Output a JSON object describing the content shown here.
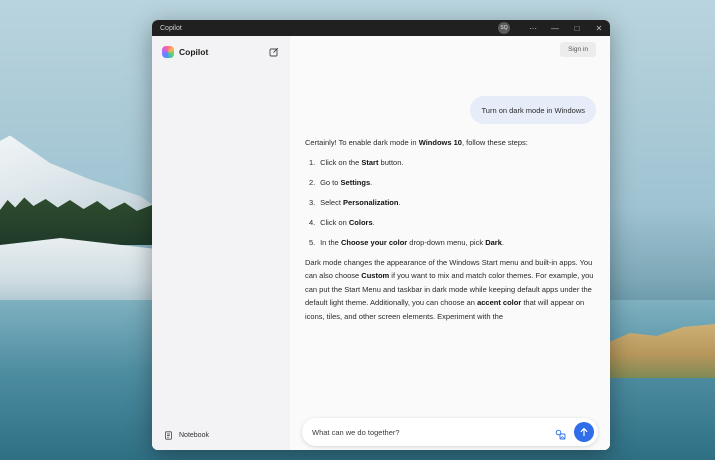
{
  "window": {
    "title": "Copilot",
    "avatar_initials": "SQ",
    "controls": {
      "more": "⋯",
      "minimize": "—",
      "maximize": "□",
      "close": "✕"
    }
  },
  "sidebar": {
    "brand": "Copilot",
    "notebook_label": "Notebook"
  },
  "header": {
    "signin_label": "Sign in"
  },
  "chat": {
    "user_message": "Turn on dark mode in Windows",
    "answer": {
      "intro_pre": "Certainly! To enable dark mode in ",
      "intro_bold": "Windows 10",
      "intro_post": ", follow these steps:",
      "steps": [
        {
          "num": "1.",
          "pre": "Click on the ",
          "bold": "Start",
          "post": " button."
        },
        {
          "num": "2.",
          "pre": "Go to ",
          "bold": "Settings",
          "post": "."
        },
        {
          "num": "3.",
          "pre": "Select ",
          "bold": "Personalization",
          "post": "."
        },
        {
          "num": "4.",
          "pre": "Click on ",
          "bold": "Colors",
          "post": "."
        },
        {
          "num": "5.",
          "pre": "In the ",
          "bold": "Choose your color",
          "mid": " drop-down menu, pick ",
          "bold2": "Dark",
          "post": "."
        }
      ],
      "para_1": "Dark mode changes the appearance of the Windows Start menu and built-in apps. You can also choose ",
      "para_bold_custom": "Custom",
      "para_2": " if you want to mix and match color themes. For example, you can put the Start Menu and taskbar in dark mode while keeping default apps under the default light theme. Additionally, you can choose an ",
      "para_bold_accent": "accent color",
      "para_3": " that will appear on icons, tiles, and other screen elements. Experiment with the"
    }
  },
  "composer": {
    "placeholder": "What can we do together?"
  },
  "colors": {
    "accent": "#2f6ee8",
    "user_bubble": "#e6ecf8",
    "sidebar_bg": "#f3f3f5"
  }
}
